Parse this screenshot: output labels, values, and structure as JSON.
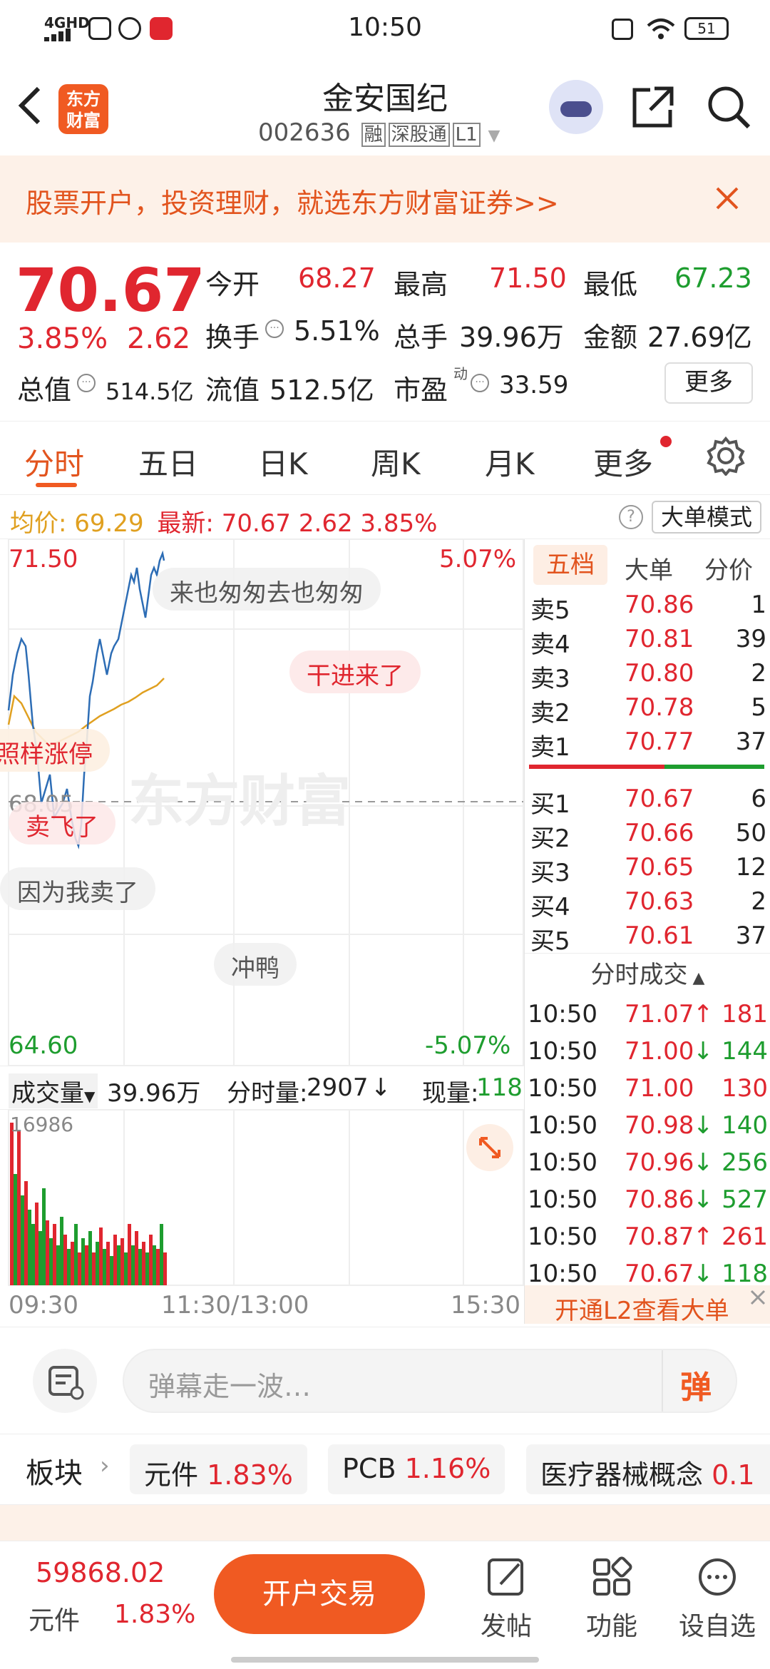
{
  "status": {
    "network": "4GHD",
    "time": "10:50",
    "battery": "51"
  },
  "header": {
    "title": "金安国纪",
    "code": "002636",
    "tags": [
      "融",
      "深股通",
      "L1"
    ],
    "logo": "东方财富"
  },
  "banner": {
    "text": "股票开户，投资理财，就选东方财富证券>>"
  },
  "quote": {
    "price": "70.67",
    "change_pct": "3.85%",
    "change": "2.62",
    "open_label": "今开",
    "open": "68.27",
    "high_label": "最高",
    "high": "71.50",
    "low_label": "最低",
    "low": "67.23",
    "turnover_label": "换手",
    "turnover": "5.51%",
    "volume_label": "总手",
    "volume": "39.96万",
    "amount_label": "金额",
    "amount": "27.69亿",
    "mktcap_label": "总值",
    "mktcap": "514.5亿",
    "float_label": "流值",
    "float": "512.5亿",
    "pe_label": "市盈",
    "pe_sup": "动",
    "pe": "33.59",
    "more": "更多"
  },
  "tabs": [
    "分时",
    "五日",
    "日K",
    "周K",
    "月K",
    "更多"
  ],
  "infobar": {
    "avg_label": "均价:",
    "avg": "69.29",
    "latest_label": "最新:",
    "latest": "70.67",
    "chg": "2.62",
    "pct": "3.85%",
    "mode": "大单模式"
  },
  "chart": {
    "y_top": "71.50",
    "y_top_pct": "5.07%",
    "y_bottom": "64.60",
    "y_bottom_pct": "-5.07%",
    "prev_close": "68.05",
    "watermark": "东方财富",
    "vol_label": "成交量",
    "vol_total": "39.96万",
    "min_vol_label": "分时量:",
    "min_vol": "2907",
    "now_label": "现量:",
    "now": "118",
    "vol_max": "16986",
    "time_start": "09:30",
    "time_mid": "11:30/13:00",
    "time_end": "15:30"
  },
  "danmu": [
    "来也匆匆去也匆匆",
    "干进来了",
    "照样涨停",
    "卖飞了",
    "因为我卖了",
    "冲鸭"
  ],
  "book": {
    "tabs": [
      "五档",
      "大单",
      "分价"
    ],
    "asks": [
      {
        "l": "卖5",
        "p": "70.86",
        "v": "1"
      },
      {
        "l": "卖4",
        "p": "70.81",
        "v": "39"
      },
      {
        "l": "卖3",
        "p": "70.80",
        "v": "2"
      },
      {
        "l": "卖2",
        "p": "70.78",
        "v": "5"
      },
      {
        "l": "卖1",
        "p": "70.77",
        "v": "37"
      }
    ],
    "bids": [
      {
        "l": "买1",
        "p": "70.67",
        "v": "6"
      },
      {
        "l": "买2",
        "p": "70.66",
        "v": "50"
      },
      {
        "l": "买3",
        "p": "70.65",
        "v": "12"
      },
      {
        "l": "买4",
        "p": "70.63",
        "v": "2"
      },
      {
        "l": "买5",
        "p": "70.61",
        "v": "37"
      }
    ],
    "ticks_title": "分时成交",
    "ticks": [
      {
        "t": "10:50",
        "p": "71.07",
        "a": "↑",
        "v": "181",
        "c": "red"
      },
      {
        "t": "10:50",
        "p": "71.00",
        "a": "↓",
        "v": "144",
        "c": "green"
      },
      {
        "t": "10:50",
        "p": "71.00",
        "a": "",
        "v": "130",
        "c": "red"
      },
      {
        "t": "10:50",
        "p": "70.98",
        "a": "↓",
        "v": "140",
        "c": "green"
      },
      {
        "t": "10:50",
        "p": "70.96",
        "a": "↓",
        "v": "256",
        "c": "green"
      },
      {
        "t": "10:50",
        "p": "70.86",
        "a": "↓",
        "v": "527",
        "c": "green"
      },
      {
        "t": "10:50",
        "p": "70.87",
        "a": "↑",
        "v": "261",
        "c": "red"
      },
      {
        "t": "10:50",
        "p": "70.67",
        "a": "↓",
        "v": "118",
        "c": "green"
      }
    ],
    "l2": "开通L2查看大单"
  },
  "input": {
    "placeholder": "弹幕走一波…",
    "btn": "弹"
  },
  "sector": {
    "label": "板块",
    "items": [
      {
        "n": "元件",
        "v": "1.83%"
      },
      {
        "n": "PCB",
        "v": "1.16%"
      },
      {
        "n": "医疗器械概念",
        "v": "0.1"
      }
    ]
  },
  "bottom": {
    "index": "59868.02",
    "index_name": "元件",
    "index_pct": "1.83%",
    "trade": "开户交易",
    "nav": [
      "发帖",
      "功能",
      "设自选"
    ]
  },
  "colors": {
    "up": "#e0262f",
    "down": "#1e9d2f",
    "accent": "#f05a22"
  }
}
